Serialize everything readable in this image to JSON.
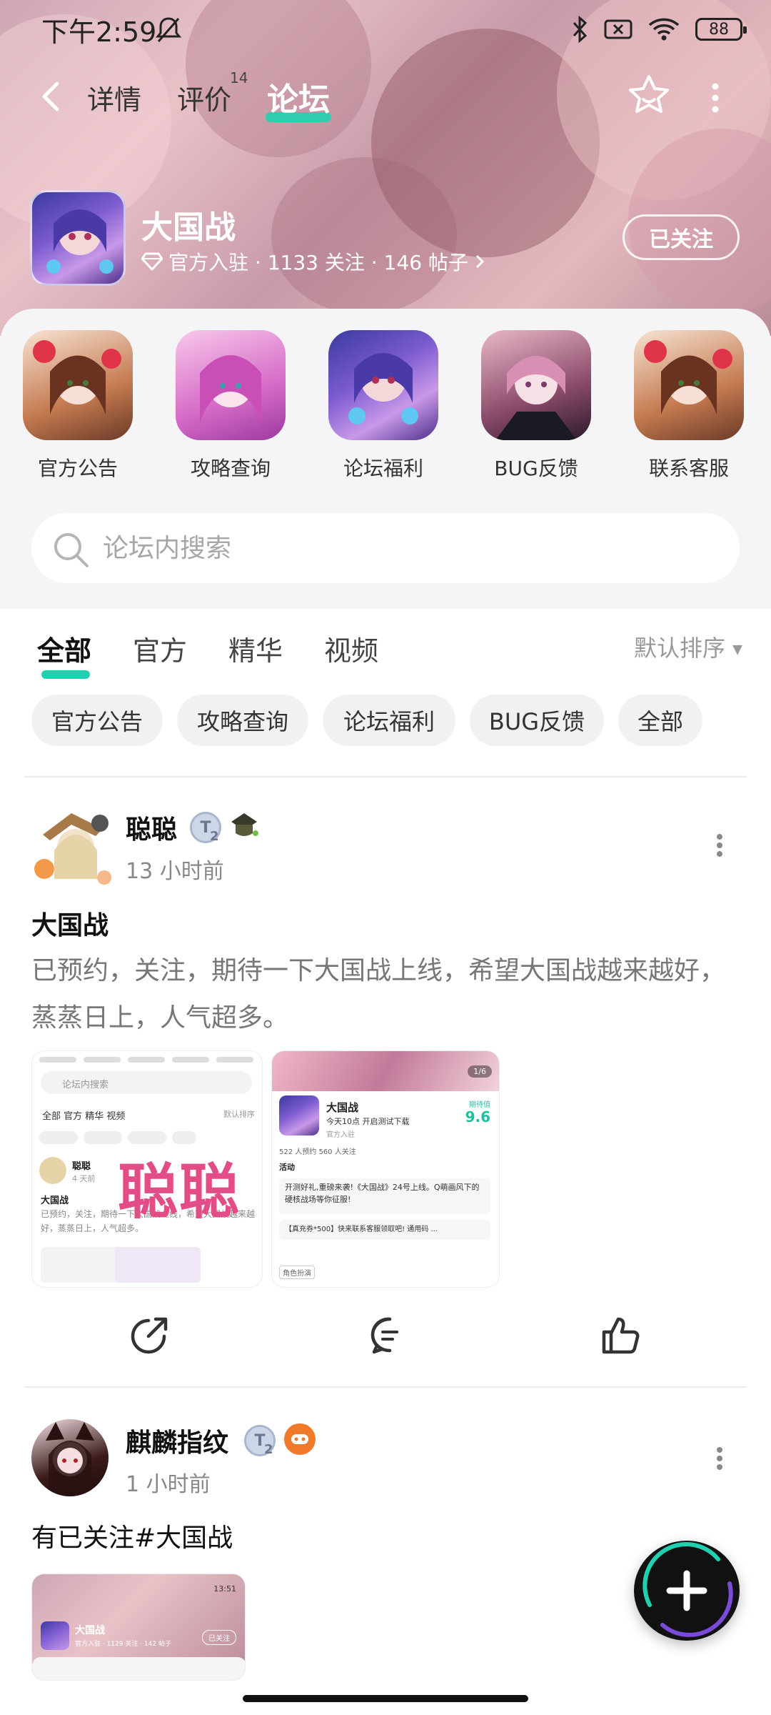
{
  "status_bar": {
    "time": "下午2:59",
    "battery": "88"
  },
  "nav": {
    "tabs": [
      {
        "label": "详情"
      },
      {
        "label": "评价",
        "badge": "14"
      },
      {
        "label": "论坛"
      }
    ],
    "active_tab": "论坛"
  },
  "game": {
    "name": "大国战",
    "meta": "官方入驻 · 1133 关注 · 146 帖子",
    "follow_label": "已关注"
  },
  "quick_links": [
    {
      "label": "官方公告"
    },
    {
      "label": "攻略查询"
    },
    {
      "label": "论坛福利"
    },
    {
      "label": "BUG反馈"
    },
    {
      "label": "联系客服"
    }
  ],
  "search": {
    "placeholder": "论坛内搜索"
  },
  "filter_tabs": [
    {
      "label": "全部"
    },
    {
      "label": "官方"
    },
    {
      "label": "精华"
    },
    {
      "label": "视频"
    }
  ],
  "sort_label": "默认排序",
  "chips": [
    {
      "label": "官方公告"
    },
    {
      "label": "攻略查询"
    },
    {
      "label": "论坛福利"
    },
    {
      "label": "BUG反馈"
    },
    {
      "label": "全部"
    }
  ],
  "posts": [
    {
      "author": "聪聪",
      "level": "2",
      "time": "13 小时前",
      "title": "大国战",
      "body": "已预约，关注，期待一下大国战上线，希望大国战越来越好，蒸蒸日上，人气超多。",
      "thumb1": {
        "watermark": "聪聪",
        "search": "论坛内搜索",
        "tabs": "全部 官方 精华 视频",
        "sort": "默认排序",
        "mini_author": "聪聪",
        "mini_time": "4 天前",
        "mini_title": "大国战",
        "mini_body": "已预约，关注，期待一下大国战上线，希望大国战越来越好，蒸蒸日上，人气超多。"
      },
      "thumb2": {
        "counter": "1/6",
        "name": "大国战",
        "tagline": "今天10点 开启测试下载",
        "score_label": "期待值",
        "score": "9.6",
        "official": "官方入驻",
        "stats": "522 人预约   560 人关注",
        "activity": "活动",
        "event1": "开测好礼,重磅来袭!《大国战》24号上线。Q萌画风下的硬核战场等你征服!",
        "event2": "【真充券*500】快来联系客服领取吧! 通用码 ...",
        "tag": "角色扮演"
      }
    },
    {
      "author": "麒麟指纹",
      "level": "2",
      "time": "1 小时前",
      "body": "有已关注#大国战",
      "thumb": {
        "name": "大国战",
        "meta": "官方入驻 · 1129 关注 · 142 帖子",
        "follow": "已关注",
        "time": "13:51"
      }
    }
  ]
}
